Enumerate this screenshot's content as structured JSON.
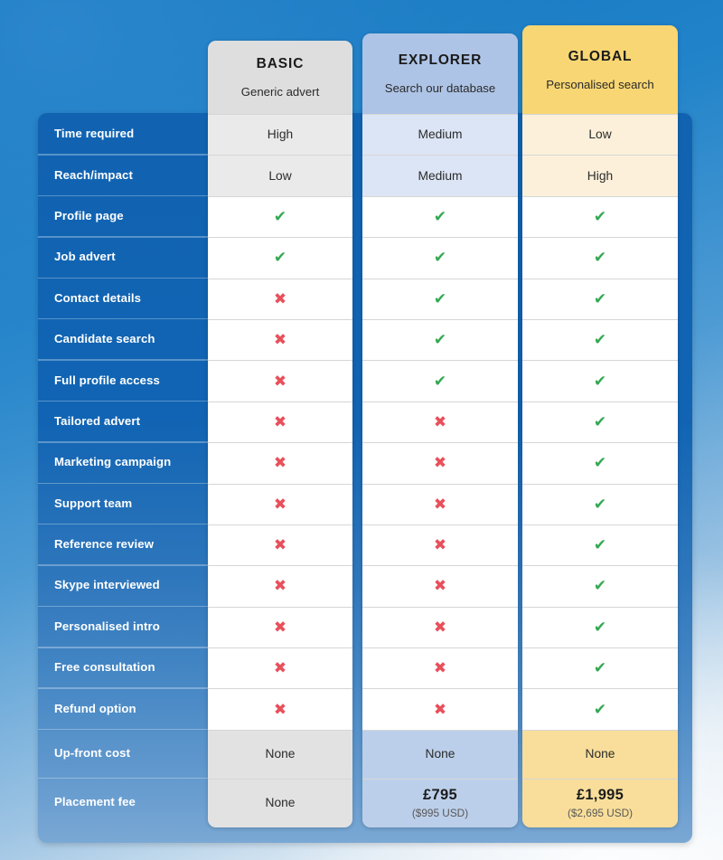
{
  "colors": {
    "page_background_top": "#1375be",
    "page_background_bottom": "#f2f6fa",
    "feature_panel_top": "#1163b2",
    "feature_panel_bottom": "#7aa8d4",
    "basic_header": "#dedede",
    "explorer_header": "#aec4e6",
    "global_header": "#f8d673",
    "yes_green": "#34a853",
    "no_red": "#e8505b"
  },
  "features": [
    {
      "label": "Time required"
    },
    {
      "label": "Reach/impact"
    },
    {
      "label": "Profile page"
    },
    {
      "label": "Job advert"
    },
    {
      "label": "Contact details"
    },
    {
      "label": "Candidate search"
    },
    {
      "label": "Full profile access"
    },
    {
      "label": "Tailored advert"
    },
    {
      "label": "Marketing campaign"
    },
    {
      "label": "Support team"
    },
    {
      "label": "Reference review"
    },
    {
      "label": "Skype interviewed"
    },
    {
      "label": "Personalised intro"
    },
    {
      "label": "Free consultation"
    },
    {
      "label": "Refund option"
    },
    {
      "label": "Up-front cost"
    },
    {
      "label": "Placement fee"
    }
  ],
  "icons": {
    "yes": "✔",
    "no": "✖",
    "yes_name": "check-icon",
    "no_name": "cross-icon"
  },
  "plans": [
    {
      "name": "BASIC",
      "tagline": "Generic advert",
      "values": [
        "High",
        "Low",
        "yes",
        "yes",
        "no",
        "no",
        "no",
        "no",
        "no",
        "no",
        "no",
        "no",
        "no",
        "no",
        "no"
      ],
      "upfront_cost": "None",
      "placement_fee": "None",
      "placement_fee_usd": ""
    },
    {
      "name": "EXPLORER",
      "tagline": "Search our database",
      "values": [
        "Medium",
        "Medium",
        "yes",
        "yes",
        "yes",
        "yes",
        "yes",
        "no",
        "no",
        "no",
        "no",
        "no",
        "no",
        "no",
        "no"
      ],
      "upfront_cost": "None",
      "placement_fee": "£795",
      "placement_fee_usd": "($995 USD)"
    },
    {
      "name": "GLOBAL",
      "tagline": "Personalised search",
      "values": [
        "Low",
        "High",
        "yes",
        "yes",
        "yes",
        "yes",
        "yes",
        "yes",
        "yes",
        "yes",
        "yes",
        "yes",
        "yes",
        "yes",
        "yes"
      ],
      "upfront_cost": "None",
      "placement_fee": "£1,995",
      "placement_fee_usd": "($2,695 USD)"
    }
  ]
}
